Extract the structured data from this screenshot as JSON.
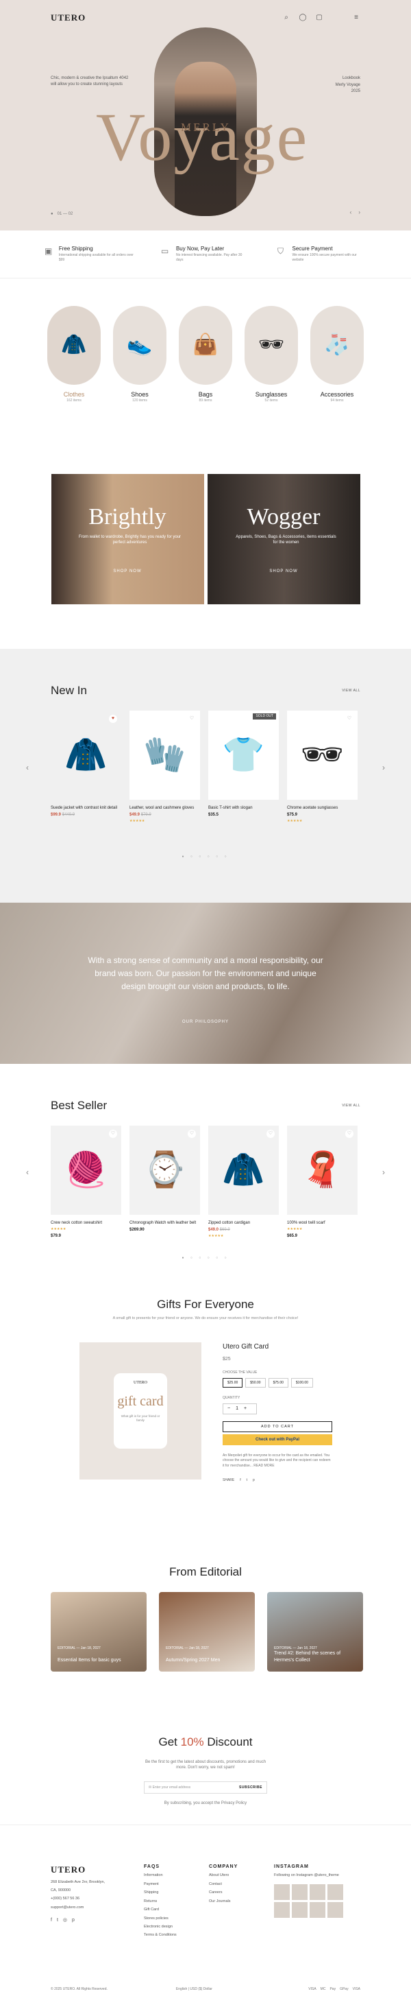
{
  "nav": {
    "logo": "UTERO",
    "icons": [
      "search-icon",
      "user-icon",
      "bag-icon",
      "menu-icon"
    ]
  },
  "hero": {
    "tagline": "Chic, modern & creative the Ipsaltum 4042 will allow you to create stunning layouts",
    "side": [
      "Lookbook",
      "Merly Voyage",
      "2025"
    ],
    "word": "Voyage",
    "sub": "MERLY",
    "pager": "01 — 02"
  },
  "features": [
    {
      "icon": "box-icon",
      "title": "Free Shipping",
      "text": "International shipping available for all orders over $99"
    },
    {
      "icon": "card-icon",
      "title": "Buy Now, Pay Later",
      "text": "No interest financing available. Pay after 30 days"
    },
    {
      "icon": "shield-icon",
      "title": "Secure Payment",
      "text": "We ensure 100% secure payment with our website"
    }
  ],
  "categories": [
    {
      "name": "Clothes",
      "count": "162 items",
      "icon": "🧥"
    },
    {
      "name": "Shoes",
      "count": "120 items",
      "icon": "👟"
    },
    {
      "name": "Bags",
      "count": "89 items",
      "icon": "👜"
    },
    {
      "name": "Sunglasses",
      "count": "52 items",
      "icon": "🕶"
    },
    {
      "name": "Accessories",
      "count": "94 items",
      "icon": "🧦"
    }
  ],
  "promos": [
    {
      "title": "Brightly",
      "text": "From wallet to wardrobe, Brightly has you ready for your perfect adventures",
      "cta": "SHOP NOW"
    },
    {
      "title": "Wogger",
      "text": "Apparels, Shoes, Bags & Accessories, items essentials for the women",
      "cta": "SHOP NOW"
    }
  ],
  "newin": {
    "title": "New In",
    "viewall": "VIEW ALL",
    "products": [
      {
        "name": "Suede jacket with contrast knit detail",
        "price": "$99.9",
        "old": "$449.9",
        "stars": "",
        "tag": ""
      },
      {
        "name": "Leather, wool and cashmere gloves",
        "price": "$49.9",
        "old": "$79.9",
        "stars": "★★★★★",
        "tag": ""
      },
      {
        "name": "Basic T-shirt with slogan",
        "price": "$35.5",
        "old": "",
        "stars": "",
        "tag": "SOLD OUT"
      },
      {
        "name": "Chrome acetate sunglasses",
        "price": "$75.9",
        "old": "",
        "stars": "★★★★★",
        "tag": ""
      }
    ]
  },
  "community": {
    "text": "With a strong sense of community and a moral responsibility, our brand was born. Our passion for the environment and unique design brought our vision and products, to life.",
    "cta": "OUR PHILOSOPHY"
  },
  "bestseller": {
    "title": "Best Seller",
    "viewall": "VIEW ALL",
    "products": [
      {
        "name": "Crew neck cotton sweatshirt",
        "price": "$79.9",
        "stars": "★★★★★"
      },
      {
        "name": "Chronograph Watch with leather belt",
        "price": "$269.90",
        "stars": ""
      },
      {
        "name": "Zipped cotton cardigan",
        "price": "$49.0",
        "old": "$69.9",
        "stars": "★★★★★"
      },
      {
        "name": "100% wool twill scarf",
        "price": "$65.9",
        "stars": "★★★★★"
      }
    ]
  },
  "gifts": {
    "title": "Gifts For Everyone",
    "subtitle": "A small gift to presents for your friend or anyone. We do ensure your receives it for merchandise of their choice!",
    "card_brand": "UTERO",
    "card_word": "gift card",
    "card_note": "What gift is for your friend or family",
    "name": "Utero Gift Card",
    "price": "$25",
    "amount_label": "CHOOSE THE VALUE",
    "amounts": [
      "$25.00",
      "$50.00",
      "$75.00",
      "$100.00"
    ],
    "qty_label": "QUANTITY",
    "qty": "1",
    "add": "ADD TO CART",
    "paypal": "Check out with PayPal",
    "note": "An Merpoliet gift for everyone to occur for the card as the emailed. You choose the amount you would like to give and the recipient can redeem it for merchandise... READ MORE",
    "share": "SHARE"
  },
  "editorial": {
    "title": "From Editorial",
    "posts": [
      {
        "meta": "EDITORIAL — Jan 18, 2027",
        "title": "Essential Items for basic guys"
      },
      {
        "meta": "EDITORIAL — Jan 18, 2027",
        "title": "Autumn/Spring 2027 Men"
      },
      {
        "meta": "EDITORIAL — Jan 18, 2027",
        "title": "Trend #2: Behind the scenes of Hermes's Collect"
      }
    ]
  },
  "discount": {
    "title_a": "Get ",
    "title_b": "10%",
    "title_c": " Discount",
    "text": "Be the first to get the latest about discounts, promotions and much more. Don't worry, we not spam!",
    "placeholder": "Enter your email address",
    "button": "SUBSCRIBE",
    "terms": "By subscribing, you accept the Privacy Policy"
  },
  "footer": {
    "logo": "UTERO",
    "address": [
      "268 Elizabeth Ave 2nr, Brooklyn,",
      "CA, 900000",
      "+(000) 567 56 36",
      "support@utero.com"
    ],
    "faqs_title": "FAQS",
    "faqs": [
      "Information",
      "Payment",
      "Shipping",
      "Returns",
      "Gift Card",
      "Stores policies",
      "Electronic design",
      "Terms & Conditions"
    ],
    "company_title": "COMPANY",
    "company": [
      "About Utero",
      "Contact",
      "Careers",
      "Our Journals"
    ],
    "insta_title": "INSTAGRAM",
    "insta_text": "Following on Instagram @utero_theme",
    "copyright": "© 2025 UTERO. All Rights Reserved.",
    "locale": "English | USD ($) Dollar",
    "pay": [
      "VISA",
      "MC",
      "Pay",
      "GPay",
      "VISA"
    ]
  },
  "colors": {
    "accent": "#b48c6a",
    "hero_bg": "#e8e0db",
    "sale": "#c8563f",
    "grey_bg": "#f0f0f0"
  }
}
